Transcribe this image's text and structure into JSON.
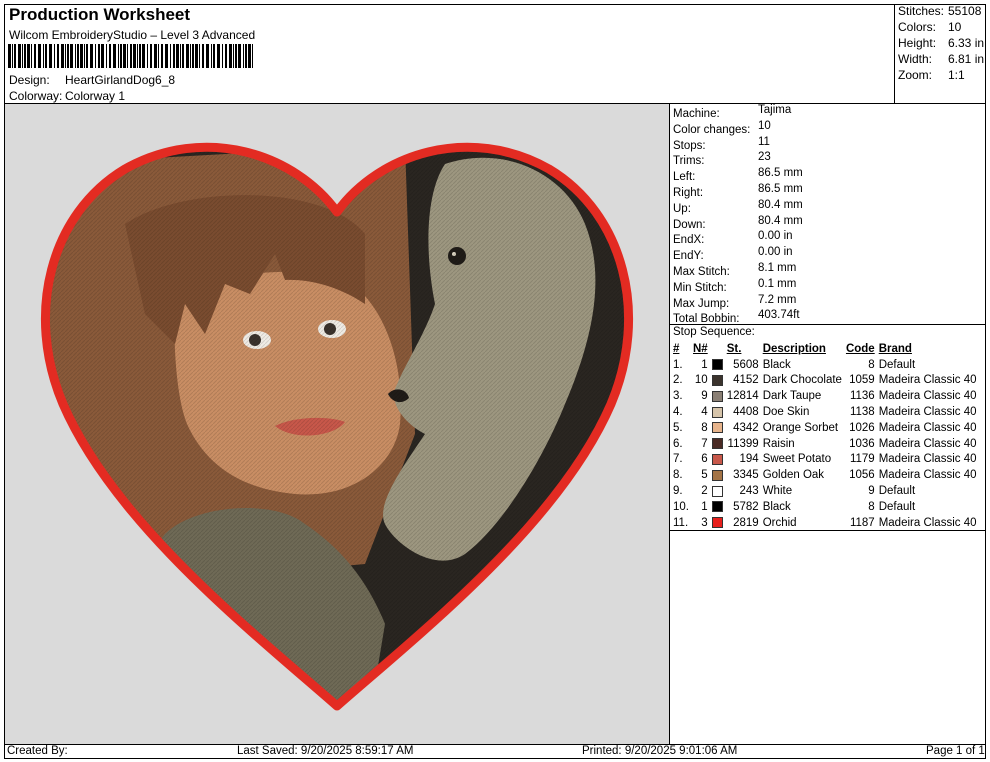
{
  "header": {
    "title": "Production Worksheet",
    "software": "Wilcom EmbroideryStudio – Level 3 Advanced",
    "design_label": "Design:",
    "design_value": "HeartGirlandDog6_8",
    "colorway_label": "Colorway:",
    "colorway_value": "Colorway 1"
  },
  "stats": [
    {
      "label": "Stitches:",
      "value": "55108"
    },
    {
      "label": "Colors:",
      "value": "10"
    },
    {
      "label": "Height:",
      "value": "6.33 in"
    },
    {
      "label": "Width:",
      "value": "6.81 in"
    },
    {
      "label": "Zoom:",
      "value": "1:1"
    }
  ],
  "machine_info": [
    {
      "label": "Machine:",
      "value": "Tajima"
    },
    {
      "label": "Color changes:",
      "value": "10"
    },
    {
      "label": "Stops:",
      "value": "11"
    },
    {
      "label": "Trims:",
      "value": "23"
    },
    {
      "label": "Left:",
      "value": "86.5 mm"
    },
    {
      "label": "Right:",
      "value": "86.5 mm"
    },
    {
      "label": "Up:",
      "value": "80.4 mm"
    },
    {
      "label": "Down:",
      "value": "80.4 mm"
    },
    {
      "label": "EndX:",
      "value": "0.00 in"
    },
    {
      "label": "EndY:",
      "value": "0.00 in"
    },
    {
      "label": "Max Stitch:",
      "value": "8.1 mm"
    },
    {
      "label": "Min Stitch:",
      "value": "0.1 mm"
    },
    {
      "label": "Max Jump:",
      "value": "7.2 mm"
    },
    {
      "label": "Total Bobbin:",
      "value": "403.74ft"
    }
  ],
  "stop_sequence": {
    "heading": "Stop Sequence:",
    "columns": {
      "idx": "#",
      "n": "N#",
      "st": "St.",
      "desc": "Description",
      "code": "Code",
      "brand": "Brand"
    },
    "rows": [
      {
        "idx": "1.",
        "n": "1",
        "color": "#000000",
        "st": "5608",
        "desc": "Black",
        "code": "8",
        "brand": "Default"
      },
      {
        "idx": "2.",
        "n": "10",
        "color": "#3b332d",
        "st": "4152",
        "desc": "Dark Chocolate",
        "code": "1059",
        "brand": "Madeira Classic 40"
      },
      {
        "idx": "3.",
        "n": "9",
        "color": "#8a7f74",
        "st": "12814",
        "desc": "Dark Taupe",
        "code": "1136",
        "brand": "Madeira Classic 40"
      },
      {
        "idx": "4.",
        "n": "4",
        "color": "#d6c4aa",
        "st": "4408",
        "desc": "Doe Skin",
        "code": "1138",
        "brand": "Madeira Classic 40"
      },
      {
        "idx": "5.",
        "n": "8",
        "color": "#e7b48c",
        "st": "4342",
        "desc": "Orange Sorbet",
        "code": "1026",
        "brand": "Madeira Classic 40"
      },
      {
        "idx": "6.",
        "n": "7",
        "color": "#4a2a24",
        "st": "11399",
        "desc": "Raisin",
        "code": "1036",
        "brand": "Madeira Classic 40"
      },
      {
        "idx": "7.",
        "n": "6",
        "color": "#c8584a",
        "st": "194",
        "desc": "Sweet Potato",
        "code": "1179",
        "brand": "Madeira Classic 40"
      },
      {
        "idx": "8.",
        "n": "5",
        "color": "#a47446",
        "st": "3345",
        "desc": "Golden Oak",
        "code": "1056",
        "brand": "Madeira Classic 40"
      },
      {
        "idx": "9.",
        "n": "2",
        "color": "#ffffff",
        "st": "243",
        "desc": "White",
        "code": "9",
        "brand": "Default"
      },
      {
        "idx": "10.",
        "n": "1",
        "color": "#000000",
        "st": "5782",
        "desc": "Black",
        "code": "8",
        "brand": "Default"
      },
      {
        "idx": "11.",
        "n": "3",
        "color": "#e8201c",
        "st": "2819",
        "desc": "Orchid",
        "code": "1187",
        "brand": "Madeira Classic 40"
      }
    ]
  },
  "footer": {
    "created_by": "Created By:",
    "last_saved": "Last Saved: 9/20/2025 8:59:17 AM",
    "printed": "Printed: 9/20/2025 9:01:06 AM",
    "page": "Page 1 of 1"
  },
  "colors": {
    "preview_bg": "#dadada",
    "heart_border": "#e32b22",
    "hair": "#8a5a3a",
    "skin": "#c98e64",
    "dog": "#9d9780",
    "dark_bg": "#2a2621"
  }
}
